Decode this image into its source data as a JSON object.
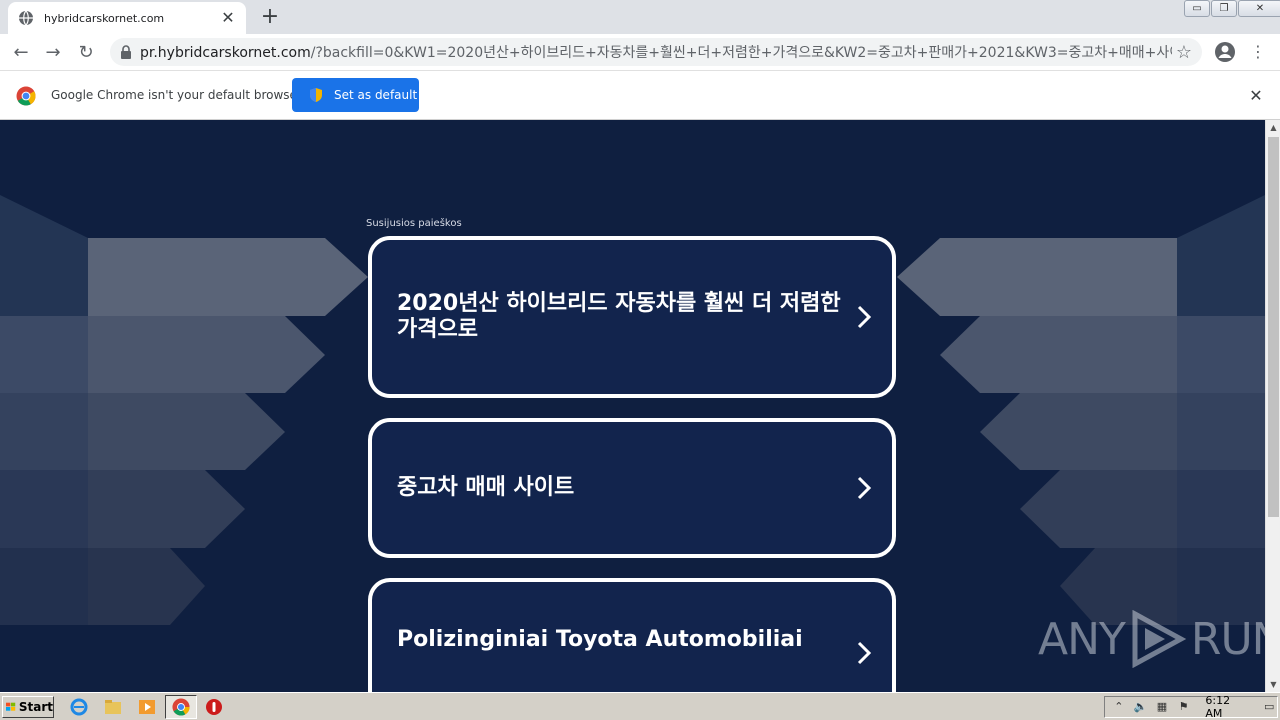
{
  "browser": {
    "tab_title": "hybridcarskornet.com",
    "url_host": "pr.hybridcarskornet.com",
    "url_rest": "/?backfill=0&KW1=2020년산+하이브리드+자동차를+훨씬+더+저렴한+가격으로&KW2=중고차+판매가+2021&KW3=중고차+매매+사이...",
    "infobar_text": "Google Chrome isn't your default browser",
    "set_default_label": "Set as default"
  },
  "page": {
    "related_label": "Susijusios paieškos",
    "cards": [
      {
        "label": "2020년산 하이브리드 자동차를 훨씬 더 저렴한 가격으로"
      },
      {
        "label": "중고차 매매 사이트"
      },
      {
        "label": "Polizinginiai Toyota Automobiliai"
      }
    ],
    "watermark_left": "ANY",
    "watermark_right": "RUN",
    "colors": {
      "background": "#0f1f40",
      "card": "#12244d",
      "accent": "#1a73e8"
    }
  },
  "taskbar": {
    "start_label": "Start",
    "clock": "6:12 AM"
  },
  "icons": [
    "globe-icon",
    "close-icon",
    "plus-icon",
    "back-icon",
    "forward-icon",
    "reload-icon",
    "lock-icon",
    "star-icon",
    "profile-icon",
    "menu-icon",
    "chrome-icon",
    "shield-icon",
    "chevron-right-icon",
    "windows-flag-icon",
    "ie-icon",
    "folder-icon",
    "media-icon",
    "opera-icon"
  ]
}
